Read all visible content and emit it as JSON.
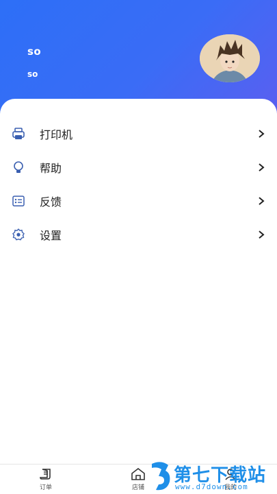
{
  "profile": {
    "name": "so",
    "subtitle": "so"
  },
  "menu": [
    {
      "label": "打印机",
      "icon": "printer-icon"
    },
    {
      "label": "帮助",
      "icon": "lightbulb-icon"
    },
    {
      "label": "反馈",
      "icon": "feedback-card-icon"
    },
    {
      "label": "设置",
      "icon": "gear-icon"
    }
  ],
  "tabs": [
    {
      "label": "订单",
      "icon": "order-icon"
    },
    {
      "label": "店铺",
      "icon": "store-icon"
    },
    {
      "label": "我的",
      "icon": "profile-icon"
    }
  ],
  "watermark": {
    "text": "第七下载站",
    "url": "www.d7down.com"
  },
  "colors": {
    "header": "#2d6ff7",
    "accent": "#1f8fe8",
    "icon": "#3a5fb0"
  }
}
